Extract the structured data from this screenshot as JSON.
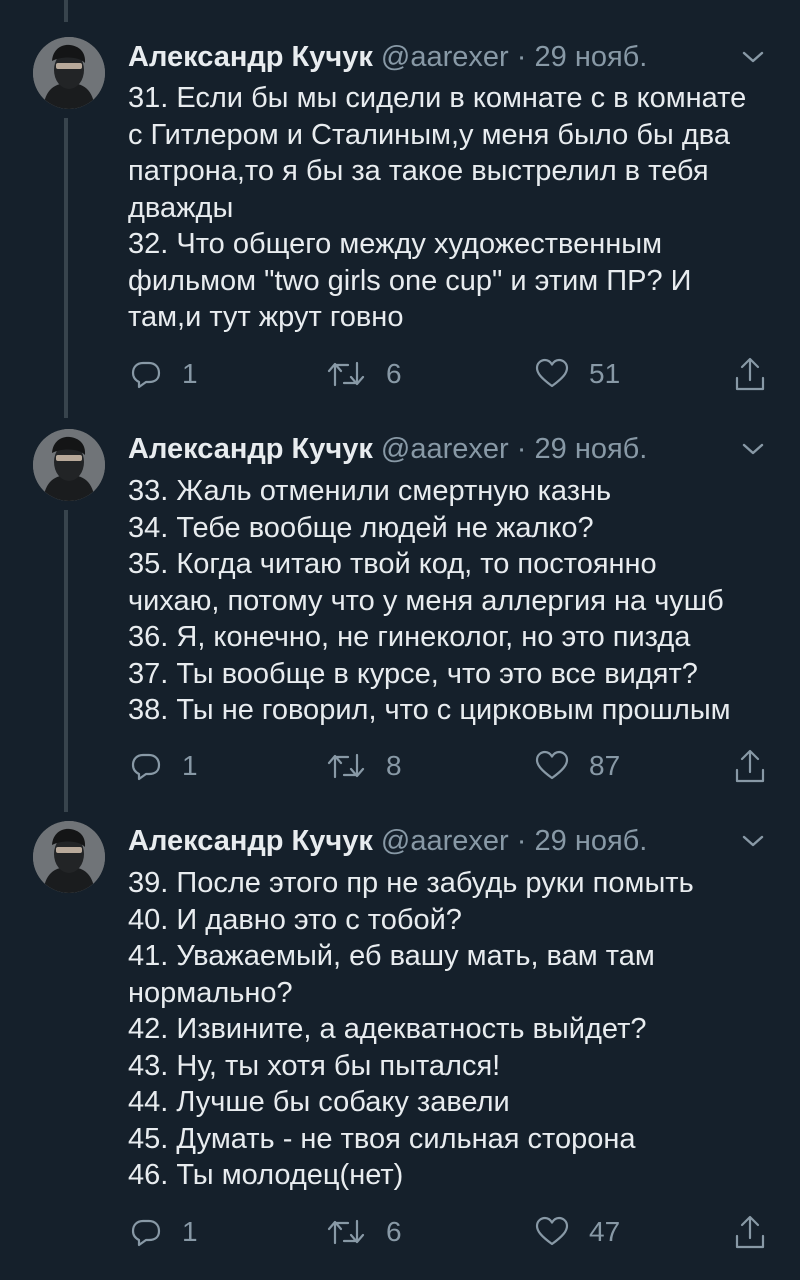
{
  "tweets": [
    {
      "author_name": "Александр Кучук",
      "handle": "@aarexer",
      "separator": "·",
      "date": "29 нояб.",
      "lines": [
        "31. Если бы мы сидели в комнате с в комнате",
        "с Гитлером и Сталиным,у меня было бы два",
        "патрона,то я бы за такое выстрелил в тебя",
        "дважды",
        "32. Что общего между художественным",
        "фильмом \"two girls one cup\" и этим ПР? И",
        "там,и тут жрут говно"
      ],
      "reply_count": "1",
      "retweet_count": "6",
      "like_count": "51"
    },
    {
      "author_name": "Александр Кучук",
      "handle": "@aarexer",
      "separator": "·",
      "date": "29 нояб.",
      "lines": [
        "33. Жаль отменили смертную казнь",
        "34. Тебе вообще людей не жалко?",
        "35. Когда читаю твой код, то постоянно",
        "чихаю, потому что у меня аллергия на чушб",
        "36. Я, конечно, не гинеколог, но это пизда",
        "37. Ты вообще в курсе, что это все видят?",
        "38. Ты не говорил, что с цирковым прошлым"
      ],
      "reply_count": "1",
      "retweet_count": "8",
      "like_count": "87"
    },
    {
      "author_name": "Александр Кучук",
      "handle": "@aarexer",
      "separator": "·",
      "date": "29 нояб.",
      "lines": [
        "39. После этого пр не забудь руки помыть",
        "40. И давно это с тобой?",
        "41. Уважаемый, еб вашу мать, вам там",
        "нормально?",
        "42. Извините, а адекватность выйдет?",
        "43. Ну, ты хотя бы пытался!",
        "44. Лучше бы собаку завели",
        "45. Думать - не твоя сильная сторона",
        "46. Ты молодец(нет)"
      ],
      "reply_count": "1",
      "retweet_count": "6",
      "like_count": "47"
    }
  ],
  "colors": {
    "background": "#15202b",
    "text": "#e8ecef",
    "secondary": "#8899a6",
    "thread_line": "#38444d"
  },
  "icons": {
    "reply": "reply-icon",
    "retweet": "retweet-icon",
    "like": "heart-icon",
    "share": "share-icon",
    "more": "chevron-down-icon"
  }
}
